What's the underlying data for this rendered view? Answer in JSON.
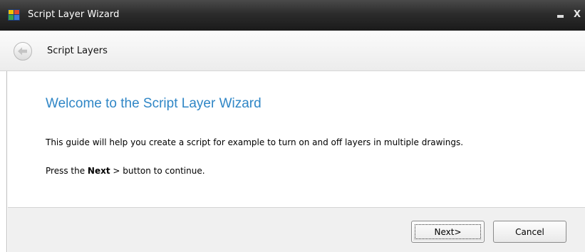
{
  "window": {
    "title": "Script Layer Wizard",
    "close_glyph": "X"
  },
  "nav": {
    "title": "Script Layers"
  },
  "content": {
    "heading": "Welcome to the Script Layer Wizard",
    "description": "This guide will help you create a script for example to turn on and off layers in multiple drawings.",
    "press_prefix": "Press the ",
    "press_bold": "Next",
    "press_suffix": " > button to continue."
  },
  "footer": {
    "next_label": "Next>",
    "cancel_label": "Cancel"
  },
  "colors": {
    "heading": "#2f86c6",
    "titlebar": "#2c2c2c"
  }
}
